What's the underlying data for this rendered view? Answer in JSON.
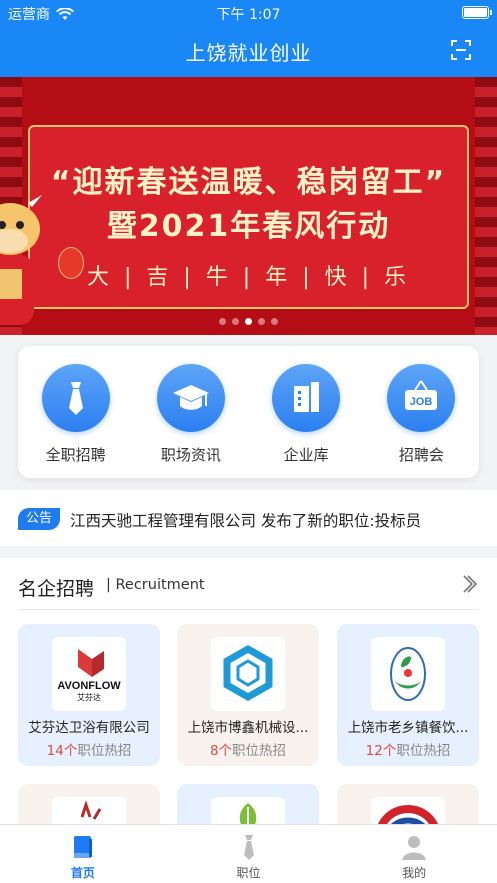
{
  "status_bar": {
    "carrier": "运营商",
    "time": "下午 1:07"
  },
  "header": {
    "title": "上饶就业创业"
  },
  "banner": {
    "line1": "“迎新春送温暖、稳岗留工”",
    "line2": "暨2021年春风行动",
    "line3": "大 | 吉 | 牛 | 年 | 快 | 乐",
    "slide_count": 5,
    "active_slide": 3
  },
  "quick_menu": [
    {
      "label": "全职招聘",
      "icon": "tie-icon"
    },
    {
      "label": "职场资讯",
      "icon": "graduation-cap-icon"
    },
    {
      "label": "企业库",
      "icon": "building-icon"
    },
    {
      "label": "招聘会",
      "icon": "job-sign-icon"
    }
  ],
  "notice": {
    "tag": "公告",
    "text": "江西天驰工程管理有限公司 发布了新的职位:投标员"
  },
  "section": {
    "title": "名企招聘",
    "subtitle": "| Recruitment"
  },
  "companies": [
    {
      "name": "艾芬达卫浴有限公司",
      "count": "14个",
      "suffix": "职位热招",
      "logo_text": "AVONFLOW",
      "logo_sub": "艾芬达"
    },
    {
      "name": "上饶市博鑫机械设...",
      "count": "8个",
      "suffix": "职位热招"
    },
    {
      "name": "上饶市老乡镇餐饮...",
      "count": "12个",
      "suffix": "职位热招"
    }
  ],
  "tabs": [
    {
      "label": "首页",
      "active": true
    },
    {
      "label": "职位",
      "active": false
    },
    {
      "label": "我的",
      "active": false
    }
  ],
  "colors": {
    "primary": "#1987f5",
    "accent_red": "#e34a3a",
    "banner_red": "#b50d16"
  }
}
